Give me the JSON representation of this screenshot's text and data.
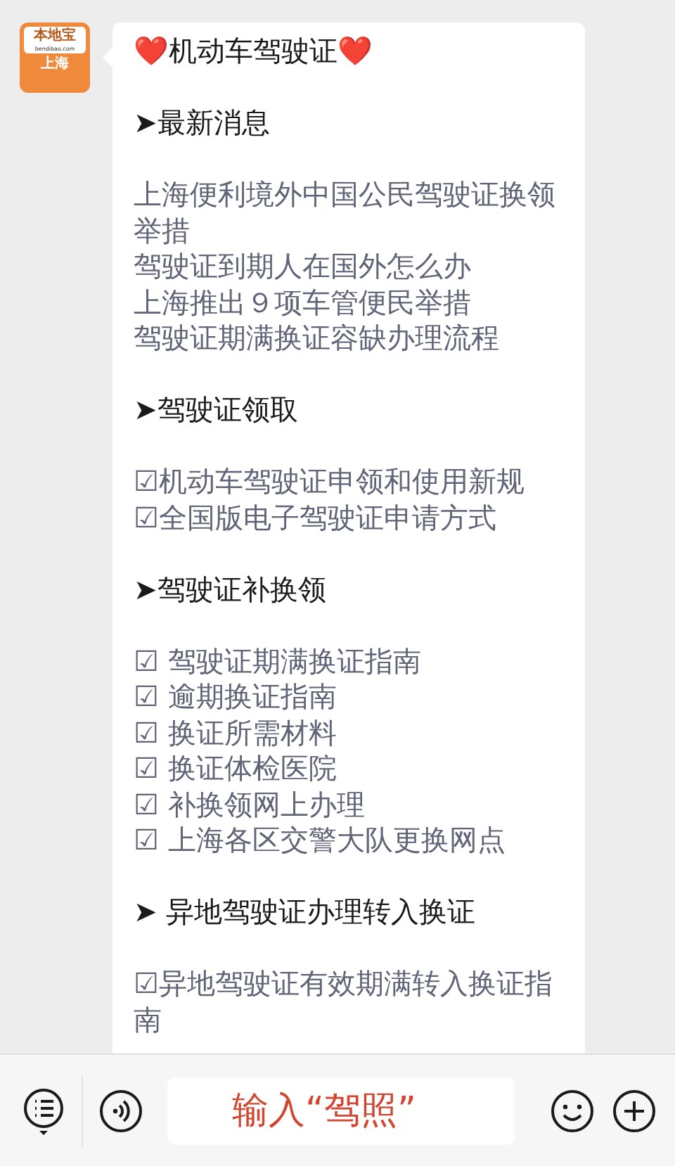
{
  "avatar": {
    "brand": "本地宝",
    "domain": "bendibao.com",
    "city": "上海"
  },
  "message": {
    "title": "❤️机动车驾驶证❤️",
    "sections": [
      {
        "heading": "➤最新消息",
        "items": [
          "上海便利境外中国公民驾驶证换领举措",
          "驾驶证到期人在国外怎么办",
          "上海推出９项车管便民举措",
          "驾驶证期满换证容缺办理流程"
        ]
      },
      {
        "heading": "➤驾驶证领取",
        "items": [
          "☑机动车驾驶证申领和使用新规",
          "☑全国版电子驾驶证申请方式"
        ]
      },
      {
        "heading": "➤驾驶证补换领",
        "items": [
          "☑ 驾驶证期满换证指南",
          "☑ 逾期换证指南",
          "☑ 换证所需材料",
          "☑ 换证体检医院",
          "☑ 补换领网上办理",
          "☑ 上海各区交警大队更换网点"
        ]
      },
      {
        "heading": "➤ 异地驾驶证办理转入换证",
        "items": [
          "☑异地驾驶证有效期满转入换证指南"
        ]
      }
    ]
  },
  "input": {
    "value": "输入“驾照”"
  }
}
